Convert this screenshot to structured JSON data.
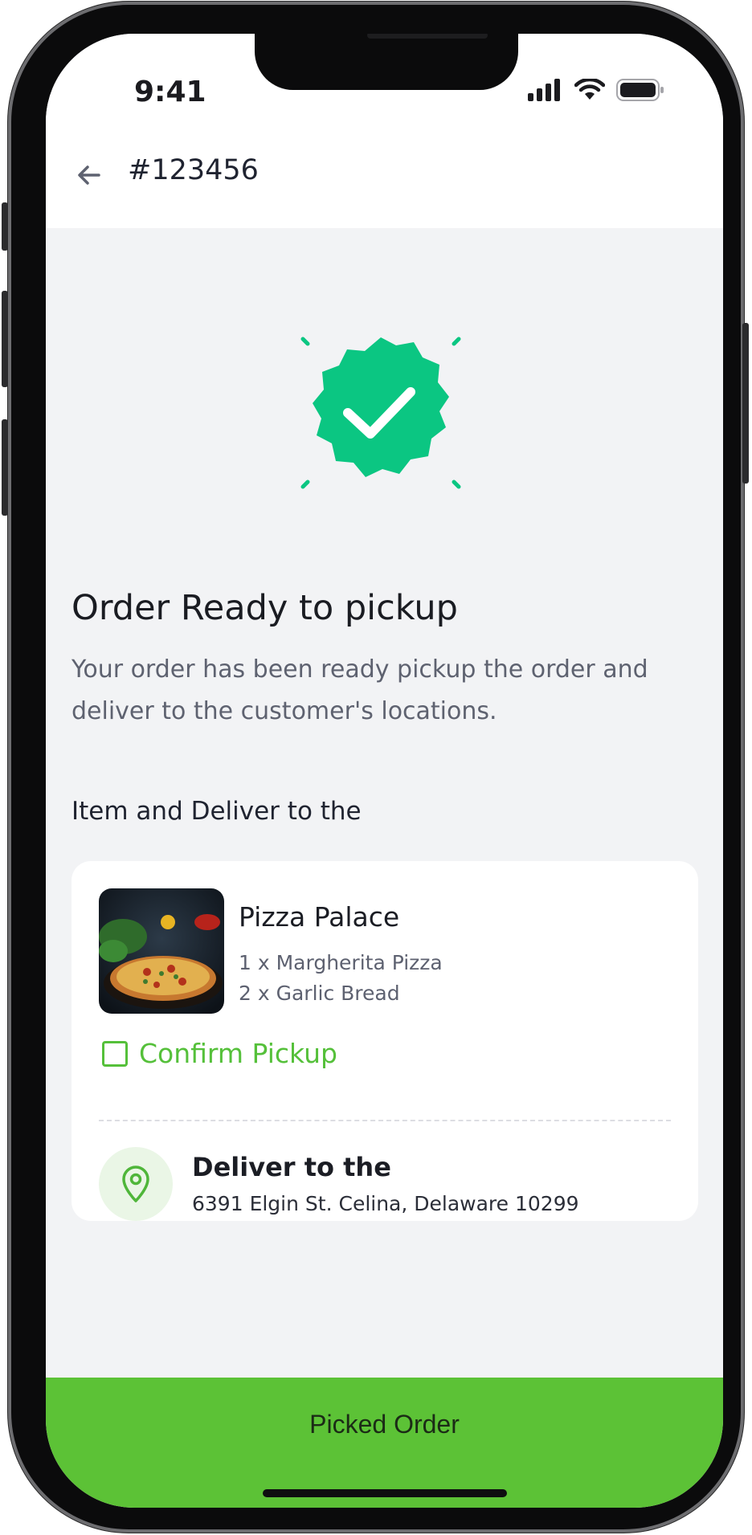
{
  "status_bar": {
    "time": "9:41"
  },
  "header": {
    "order_id": "#123456"
  },
  "success": {
    "title": "Order Ready to pickup",
    "description": "Your order has been ready pickup the order and deliver to the customer's locations."
  },
  "section_title": "Item and Deliver to the",
  "order_card": {
    "store_name": "Pizza Palace",
    "items": [
      "1 x Margherita Pizza",
      "2 x Garlic Bread"
    ],
    "confirm_label": "Confirm Pickup",
    "confirm_checked": false,
    "deliver_title": "Deliver to the",
    "deliver_address": "6391 Elgin St. Celina, Delaware 10299"
  },
  "cta": {
    "label": "Picked Order"
  },
  "colors": {
    "accent_green": "#5cc236",
    "badge_green": "#0bc682",
    "background": "#f2f3f5"
  },
  "icons": [
    "back-arrow-icon",
    "signal-icon",
    "wifi-icon",
    "battery-icon",
    "check-badge-icon",
    "location-pin-icon"
  ]
}
